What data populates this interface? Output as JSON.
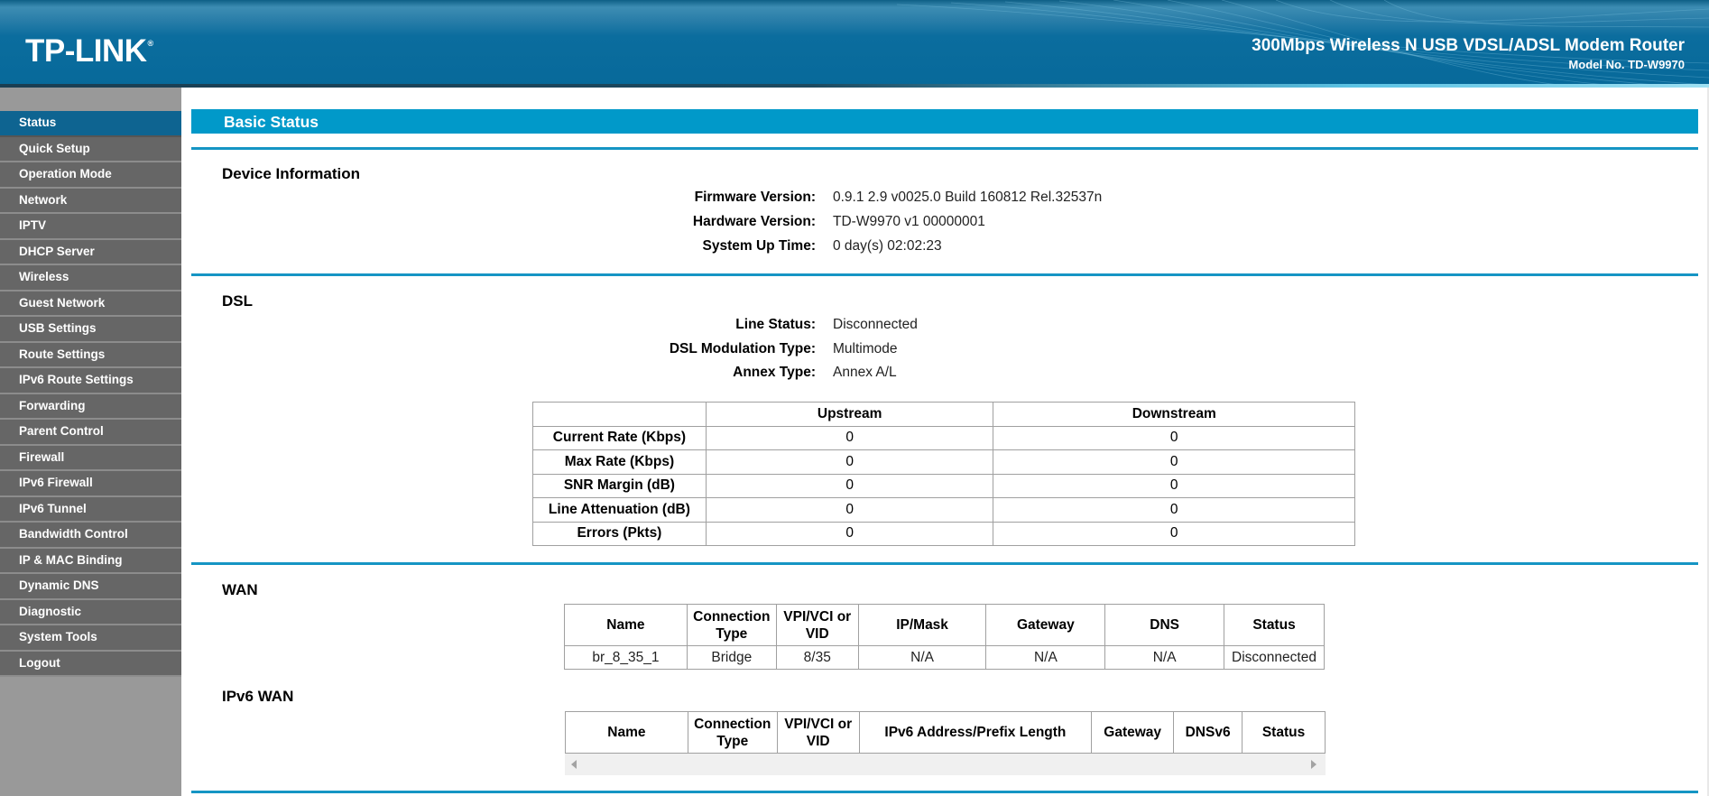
{
  "header": {
    "logo": "TP-LINK",
    "logo_mark": "®",
    "product_name": "300Mbps Wireless N USB VDSL/ADSL Modem Router",
    "model": "Model No. TD-W9970"
  },
  "sidebar": {
    "active": "Status",
    "items": [
      {
        "label": "Status"
      },
      {
        "label": "Quick Setup"
      },
      {
        "label": "Operation Mode"
      },
      {
        "label": "Network"
      },
      {
        "label": "IPTV"
      },
      {
        "label": "DHCP Server"
      },
      {
        "label": "Wireless"
      },
      {
        "label": "Guest Network"
      },
      {
        "label": "USB Settings"
      },
      {
        "label": "Route Settings"
      },
      {
        "label": "IPv6 Route Settings"
      },
      {
        "label": "Forwarding"
      },
      {
        "label": "Parent Control"
      },
      {
        "label": "Firewall"
      },
      {
        "label": "IPv6 Firewall"
      },
      {
        "label": "IPv6 Tunnel"
      },
      {
        "label": "Bandwidth Control"
      },
      {
        "label": "IP & MAC Binding"
      },
      {
        "label": "Dynamic DNS"
      },
      {
        "label": "Diagnostic"
      },
      {
        "label": "System Tools"
      },
      {
        "label": "Logout"
      }
    ]
  },
  "main": {
    "title": "Basic Status",
    "device_info": {
      "heading": "Device Information",
      "rows": [
        {
          "label": "Firmware Version:",
          "value": "0.9.1 2.9 v0025.0 Build 160812 Rel.32537n"
        },
        {
          "label": "Hardware Version:",
          "value": "TD-W9970 v1 00000001"
        },
        {
          "label": "System Up Time:",
          "value": "0 day(s) 02:02:23"
        }
      ]
    },
    "dsl": {
      "heading": "DSL",
      "rows": [
        {
          "label": "Line Status:",
          "value": "Disconnected"
        },
        {
          "label": "DSL Modulation Type:",
          "value": "Multimode"
        },
        {
          "label": "Annex Type:",
          "value": "Annex A/L"
        }
      ],
      "table": {
        "columns": [
          "",
          "Upstream",
          "Downstream"
        ],
        "rows": [
          {
            "label": "Current Rate (Kbps)",
            "up": "0",
            "down": "0"
          },
          {
            "label": "Max Rate (Kbps)",
            "up": "0",
            "down": "0"
          },
          {
            "label": "SNR Margin (dB)",
            "up": "0",
            "down": "0"
          },
          {
            "label": "Line Attenuation (dB)",
            "up": "0",
            "down": "0"
          },
          {
            "label": "Errors (Pkts)",
            "up": "0",
            "down": "0"
          }
        ]
      }
    },
    "wan": {
      "heading": "WAN",
      "columns": [
        "Name",
        "Connection Type",
        "VPI/VCI or VID",
        "IP/Mask",
        "Gateway",
        "DNS",
        "Status"
      ],
      "rows": [
        [
          "br_8_35_1",
          "Bridge",
          "8/35",
          "N/A",
          "N/A",
          "N/A",
          "Disconnected"
        ]
      ]
    },
    "ipv6_wan": {
      "heading": "IPv6 WAN",
      "columns": [
        "Name",
        "Connection Type",
        "VPI/VCI or VID",
        "IPv6 Address/Prefix Length",
        "Gateway",
        "DNSv6",
        "Status"
      ],
      "rows": []
    }
  }
}
